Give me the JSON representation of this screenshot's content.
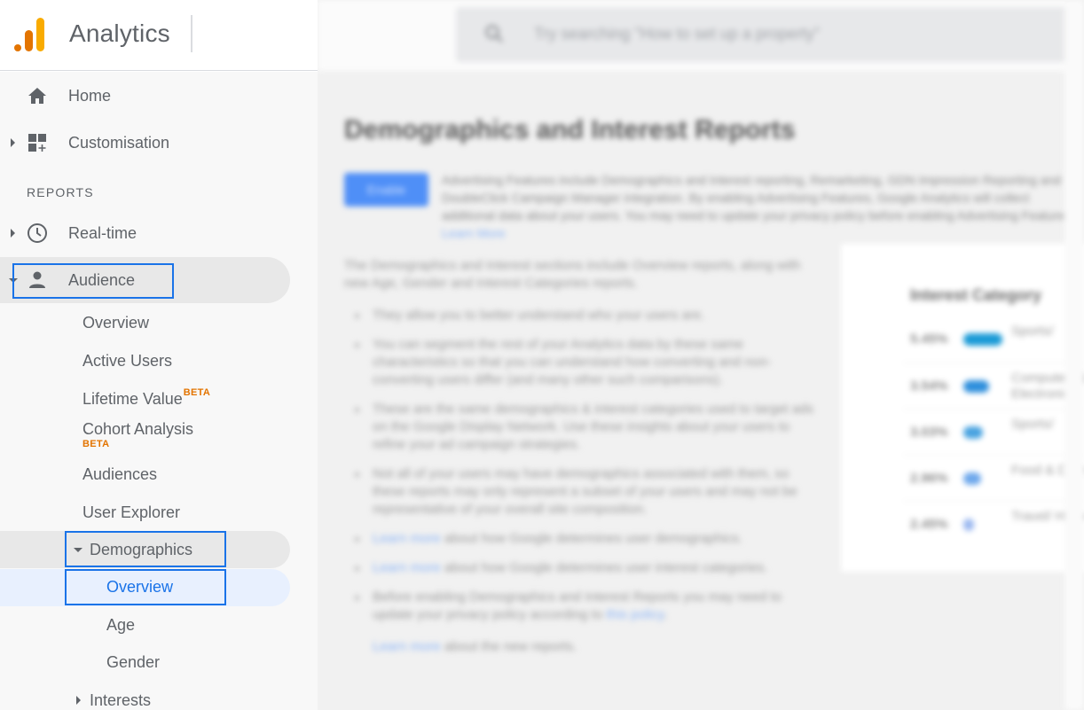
{
  "header": {
    "app_title": "Analytics"
  },
  "search": {
    "placeholder": "Try searching \"How to set up a property\""
  },
  "sidebar": {
    "top_items": [
      {
        "label": "Home",
        "icon": "home-icon"
      },
      {
        "label": "Customisation",
        "icon": "dashboard-add-icon"
      }
    ],
    "section_label": "REPORTS",
    "realtime": {
      "label": "Real-time",
      "icon": "clock-icon"
    },
    "audience": {
      "label": "Audience",
      "icon": "person-icon",
      "children": [
        {
          "label": "Overview"
        },
        {
          "label": "Active Users"
        },
        {
          "label": "Lifetime Value",
          "badge": "BETA"
        },
        {
          "label": "Cohort Analysis",
          "badge": "BETA"
        },
        {
          "label": "Audiences"
        },
        {
          "label": "User Explorer"
        }
      ],
      "demographics": {
        "label": "Demographics",
        "children": [
          {
            "label": "Overview",
            "active": true
          },
          {
            "label": "Age"
          },
          {
            "label": "Gender"
          }
        ]
      },
      "interests": {
        "label": "Interests"
      }
    }
  },
  "main": {
    "title": "Demographics and Interest Reports",
    "enable_button": "Enable",
    "advertising_text": "Advertising Features include Demographics and Interest reporting, Remarketing, GDN Impression Reporting and DoubleClick Campaign Manager integration. By enabling Advertising Features, Google Analytics will collect additional data about your users. You may need to update your privacy policy before enabling Advertising Features.",
    "advertising_link": "Learn More",
    "intro": "The Demographics and Interest sections include Overview reports, along with new Age, Gender and Interest Categories reports.",
    "bullets": [
      {
        "text": "They allow you to better understand who your users are."
      },
      {
        "text": "You can segment the rest of your Analytics data by these same characteristics so that you can understand how converting and non-converting users differ (and many other such comparisons)."
      },
      {
        "text": "These are the same demographics & interest categories used to target ads on the Google Display Network. Use these insights about your users to refine your ad campaign strategies."
      },
      {
        "text": "Not all of your users may have demographics associated with them, so these reports may only represent a subset of your users and may not be representative of your overall site composition."
      },
      {
        "link": "Learn more",
        "text": " about how Google determines user demographics."
      },
      {
        "link": "Learn more",
        "text": " about how Google determines user interest categories."
      },
      {
        "text": "Before enabling Demographics and Interest Reports you may need to update your privacy policy according to ",
        "link_after": "this policy",
        "text_end": "."
      }
    ],
    "footer_link": "Learn more",
    "footer_text": " about the new reports.",
    "interest_card": {
      "title": "Interest Category",
      "rows": [
        {
          "percent": "5.45%",
          "name": "Sports/",
          "share": 1.0,
          "color": "#1a9ad6"
        },
        {
          "percent": "3.54%",
          "name": "Computers & Electronics",
          "share": 0.65,
          "color": "#2f8fdc"
        },
        {
          "percent": "3.03%",
          "name": "Sports/",
          "share": 0.5,
          "color": "#4aa3e0"
        },
        {
          "percent": "2.96%",
          "name": "Food & Dining",
          "share": 0.45,
          "color": "#6ea8ec"
        },
        {
          "percent": "2.45%",
          "name": "Travel/ Historical",
          "share": 0.25,
          "color": "#9bb8f0"
        }
      ]
    }
  },
  "colors": {
    "accent_blue": "#1a73e8",
    "beta_orange": "#e37400",
    "logo_orange": "#e37400",
    "logo_yellow": "#f9ab00",
    "active_bg": "#e8f0fe"
  }
}
